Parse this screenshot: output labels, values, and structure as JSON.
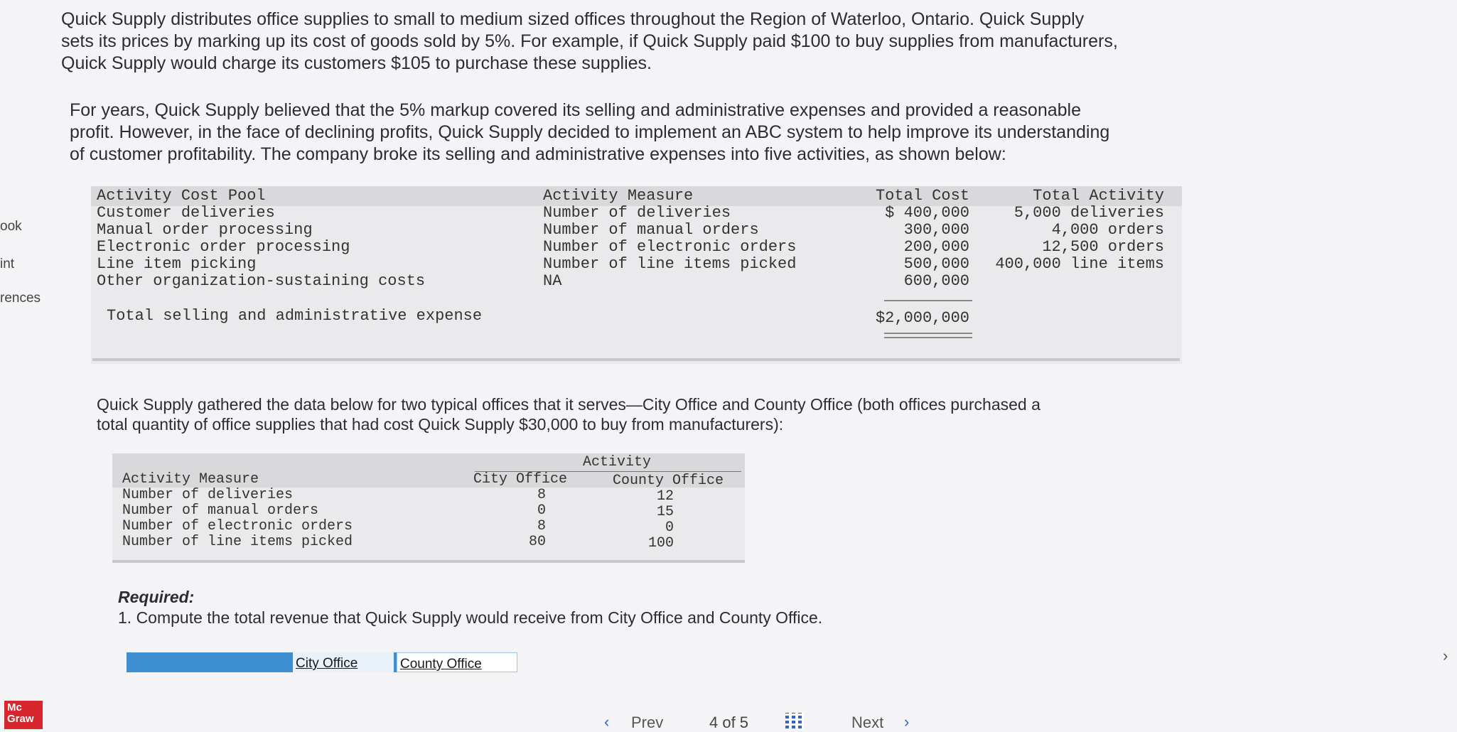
{
  "left_nav": {
    "items": [
      "ook",
      "int",
      "rences"
    ]
  },
  "logo": {
    "text": "Mc\nGraw"
  },
  "intro": {
    "line1": "Quick Supply distributes office supplies to small to medium sized offices throughout the Region of Waterloo, Ontario. Quick Supply",
    "line2": "sets its prices by marking up its cost of goods sold by 5%. For example, if Quick Supply paid $100 to buy supplies from manufacturers,",
    "line3": "Quick Supply would charge its customers $105 to purchase these supplies."
  },
  "para2": {
    "line1": "For years, Quick Supply believed that the 5% markup covered its selling and administrative expenses and provided a reasonable",
    "line2": "profit. However, in the face of declining profits, Quick Supply decided to implement an ABC system to help improve its understanding",
    "line3": "of customer profitability. The company broke its selling and administrative expenses into five activities, as shown below:"
  },
  "activity_table": {
    "headers": {
      "pool": "Activity Cost Pool",
      "measure": "Activity Measure",
      "cost": "Total Cost",
      "activity": "Total Activity"
    },
    "rows": [
      {
        "pool": "Customer deliveries",
        "measure": "Number of deliveries",
        "cost": "$  400,000",
        "activity": "5,000 deliveries"
      },
      {
        "pool": "Manual order processing",
        "measure": "Number of manual orders",
        "cost": "300,000",
        "activity": "4,000 orders"
      },
      {
        "pool": "Electronic order processing",
        "measure": "Number of electronic orders",
        "cost": "200,000",
        "activity": "12,500 orders"
      },
      {
        "pool": "Line item picking",
        "measure": "Number of line items picked",
        "cost": "500,000",
        "activity": "400,000 line items"
      },
      {
        "pool": "Other organization-sustaining costs",
        "measure": "NA",
        "cost": "600,000",
        "activity": ""
      }
    ],
    "total_label": "Total selling and administrative expense",
    "total_value": "$2,000,000"
  },
  "para3": {
    "line1": "Quick Supply gathered the data below for two typical offices that it serves—City Office and County Office (both offices purchased a",
    "line2": "total quantity of office supplies that had cost Quick Supply $30,000 to buy from manufacturers):"
  },
  "office_table": {
    "group_header": "Activity",
    "headers": {
      "measure": "Activity Measure",
      "city": "City Office",
      "county": "County Office"
    },
    "rows": [
      {
        "measure": "Number of deliveries",
        "city": "8",
        "county": "12"
      },
      {
        "measure": "Number of manual orders",
        "city": "0",
        "county": "15"
      },
      {
        "measure": "Number of electronic orders",
        "city": "8",
        "county": "0"
      },
      {
        "measure": "Number of line items picked",
        "city": "80",
        "county": "100"
      }
    ]
  },
  "required": {
    "heading": "Required:",
    "item1": "1. Compute the total revenue that Quick Supply would receive from City Office and County Office."
  },
  "tabs": [
    "City Office",
    "County Office"
  ],
  "pager": {
    "prev": "Prev",
    "position": "4 of 5",
    "next": "Next"
  },
  "icons": {
    "grid": "grid-icon",
    "prev": "chevron-left-icon",
    "next": "chevron-right-icon",
    "side": "chevron-right-icon"
  }
}
